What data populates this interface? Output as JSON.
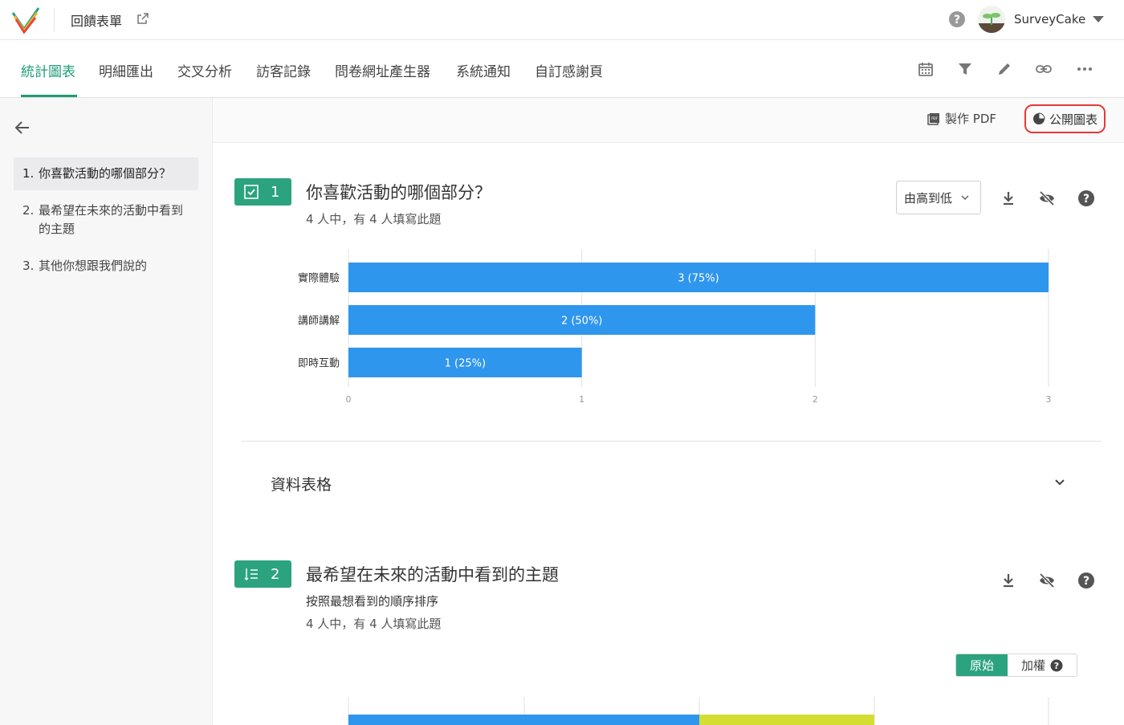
{
  "header": {
    "form_title": "回饋表單",
    "user_name": "SurveyCake",
    "logo_colors": [
      "#2ba37f",
      "#f2b632",
      "#e5493a"
    ]
  },
  "tabs": [
    {
      "label": "統計圖表",
      "active": true
    },
    {
      "label": "明細匯出",
      "active": false
    },
    {
      "label": "交叉分析",
      "active": false
    },
    {
      "label": "訪客記錄",
      "active": false
    },
    {
      "label": "問卷網址產生器",
      "active": false
    },
    {
      "label": "系統通知",
      "active": false
    },
    {
      "label": "自訂感謝頁",
      "active": false
    }
  ],
  "tool_icons": [
    "calendar-icon",
    "filter-icon",
    "pencil-icon",
    "link-icon",
    "more-icon"
  ],
  "sidebar": {
    "items": [
      {
        "num": "1.",
        "label": "你喜歡活動的哪個部分？",
        "active": true
      },
      {
        "num": "2.",
        "label": "最希望在未來的活動中看到的主題",
        "active": false
      },
      {
        "num": "3.",
        "label": "其他你想跟我們說的",
        "active": false
      }
    ]
  },
  "toolbar": {
    "pdf_label": "製作 PDF",
    "public_label": "公開圖表"
  },
  "q1": {
    "num": "1",
    "title": "你喜歡活動的哪個部分？",
    "meta": "4 人中，有 4 人填寫此題",
    "sort_label": "由高到低"
  },
  "data_table": {
    "label": "資料表格"
  },
  "q2": {
    "num": "2",
    "title": "最希望在未來的活動中看到的主題",
    "subtitle": "按照最想看到的順序排序",
    "meta": "4 人中，有 4 人填寫此題",
    "toggle_raw": "原始",
    "toggle_weighted": "加權"
  },
  "colors": {
    "accent": "#2ba37f",
    "bar": "#2f96ee",
    "bar_alt": "#d4de32",
    "highlight": "#e53935"
  },
  "chart_data": [
    {
      "type": "bar",
      "orientation": "horizontal",
      "categories": [
        "實際體驗",
        "講師講解",
        "即時互動"
      ],
      "values": [
        3,
        2,
        1
      ],
      "labels": [
        "3 (75%)",
        "2 (50%)",
        "1 (25%)"
      ],
      "xlim": [
        0,
        3
      ],
      "x_ticks": [
        "0",
        "1",
        "2",
        "3"
      ],
      "grid": true
    },
    {
      "type": "bar",
      "orientation": "horizontal",
      "stacked": true,
      "partially_visible": true,
      "grid": true
    }
  ]
}
